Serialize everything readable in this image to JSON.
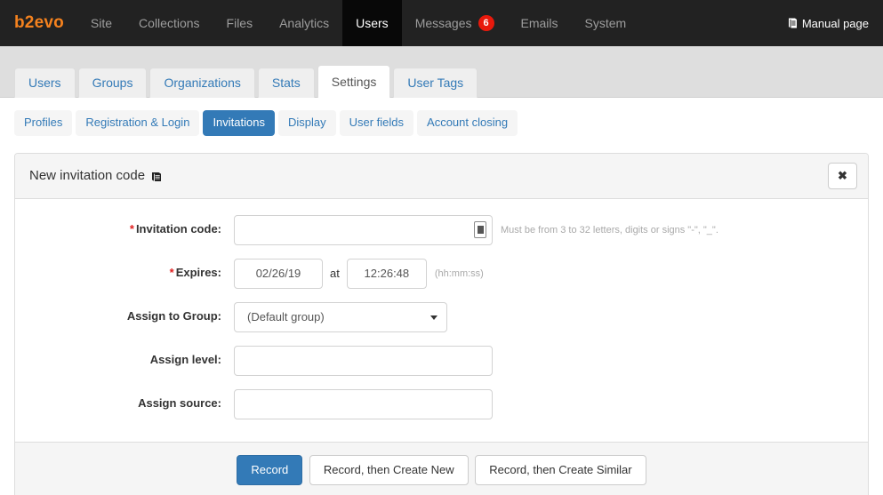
{
  "navbar": {
    "brand": "b2evo",
    "items": [
      {
        "label": "Site",
        "active": false
      },
      {
        "label": "Collections",
        "active": false
      },
      {
        "label": "Files",
        "active": false
      },
      {
        "label": "Analytics",
        "active": false
      },
      {
        "label": "Users",
        "active": true
      },
      {
        "label": "Messages",
        "active": false,
        "badge": "6"
      },
      {
        "label": "Emails",
        "active": false
      },
      {
        "label": "System",
        "active": false
      }
    ],
    "manual_label": "Manual page",
    "manual_icon": "book-icon",
    "bg_color": "#222222",
    "active_bg_color": "#080808",
    "brand_color": "#f5821e",
    "badge_color": "#e8190c"
  },
  "tabs": [
    {
      "label": "Users",
      "active": false
    },
    {
      "label": "Groups",
      "active": false
    },
    {
      "label": "Organizations",
      "active": false
    },
    {
      "label": "Stats",
      "active": false
    },
    {
      "label": "Settings",
      "active": true
    },
    {
      "label": "User Tags",
      "active": false
    }
  ],
  "subtabs": [
    {
      "label": "Profiles",
      "active": false
    },
    {
      "label": "Registration & Login",
      "active": false
    },
    {
      "label": "Invitations",
      "active": true
    },
    {
      "label": "Display",
      "active": false
    },
    {
      "label": "User fields",
      "active": false
    },
    {
      "label": "Account closing",
      "active": false
    }
  ],
  "panel": {
    "title": "New invitation code",
    "title_icon": "manual-book-icon",
    "close_label": "✖",
    "close_icon": "close-icon",
    "accent_color": "#337ab7"
  },
  "form": {
    "invitation_code": {
      "label": "Invitation code:",
      "required_mark": "*",
      "value": "",
      "placeholder": "",
      "generate_icon": "generate-code-icon",
      "hint": "Must be from 3 to 32 letters, digits or signs \"-\", \"_\"."
    },
    "expires": {
      "label": "Expires:",
      "required_mark": "*",
      "date_value": "02/26/19",
      "at_text": "at",
      "time_value": "12:26:48",
      "hint": "(hh:mm:ss)"
    },
    "assign_group": {
      "label": "Assign to Group:",
      "selected": "(Default group)",
      "options": [
        "(Default group)"
      ]
    },
    "assign_level": {
      "label": "Assign level:",
      "value": ""
    },
    "assign_source": {
      "label": "Assign source:",
      "value": ""
    }
  },
  "footer": {
    "record": "Record",
    "record_new": "Record, then Create New",
    "record_similar": "Record, then Create Similar"
  }
}
